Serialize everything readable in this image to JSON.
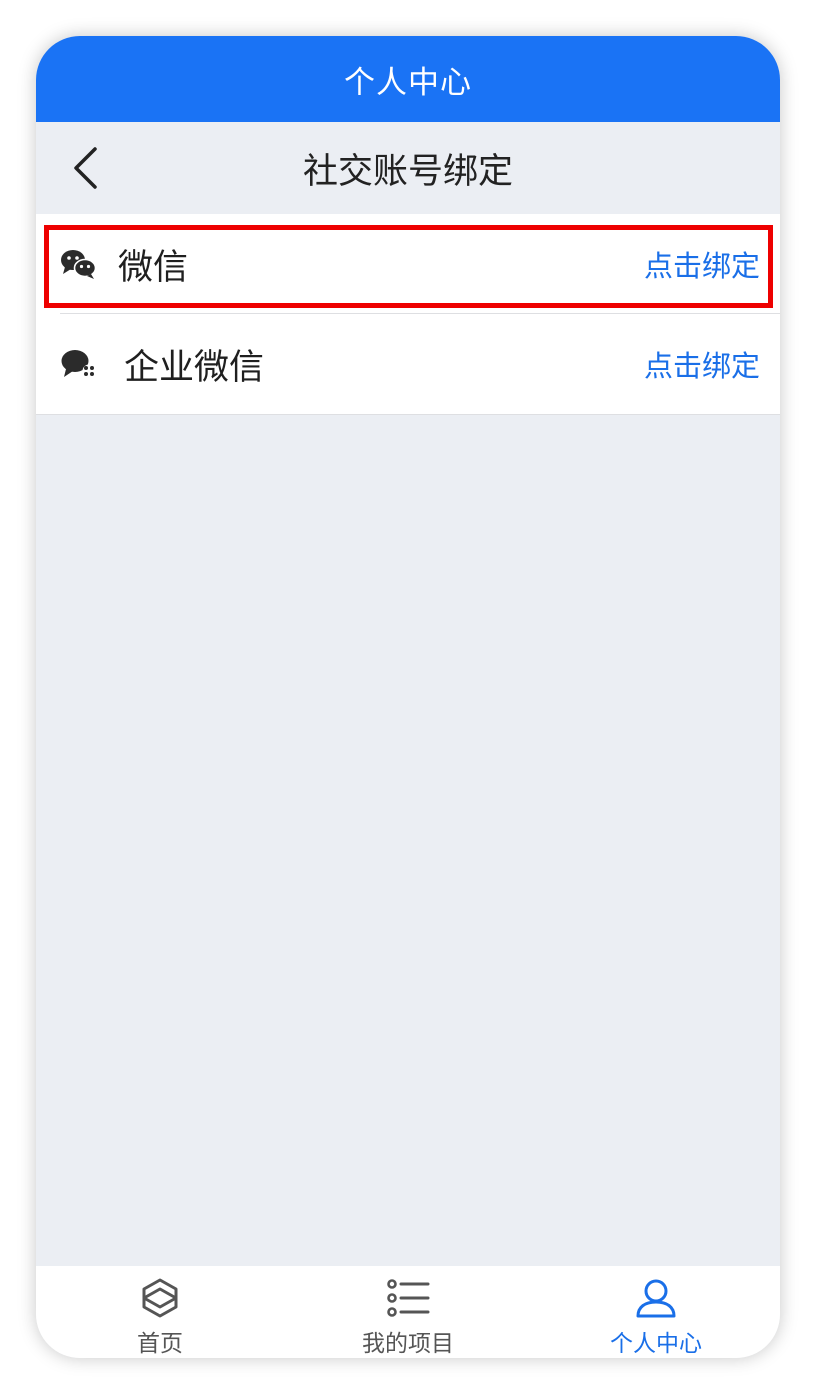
{
  "header": {
    "title": "个人中心",
    "color": "#1a73f5"
  },
  "navbar": {
    "title": "社交账号绑定",
    "back_icon": "chevron-left-icon"
  },
  "bindings": [
    {
      "label": "微信",
      "action": "点击绑定",
      "icon": "wechat-icon",
      "highlighted": true
    },
    {
      "label": "企业微信",
      "action": "点击绑定",
      "icon": "wecom-icon",
      "highlighted": false
    }
  ],
  "tabbar": {
    "tabs": [
      {
        "label": "首页",
        "icon": "home-cube-icon",
        "active": false
      },
      {
        "label": "我的项目",
        "icon": "list-icon",
        "active": false
      },
      {
        "label": "个人中心",
        "icon": "user-icon",
        "active": true
      }
    ],
    "active_color": "#1a6fe8"
  },
  "highlight_color": "#ee0000"
}
